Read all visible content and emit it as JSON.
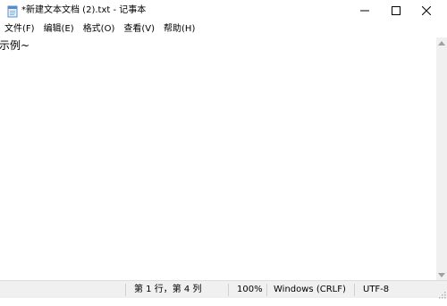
{
  "window": {
    "title": "*新建文本文档 (2).txt - 记事本",
    "icon": "notepad-icon"
  },
  "menu": {
    "items": [
      {
        "label": "文件(F)"
      },
      {
        "label": "编辑(E)"
      },
      {
        "label": "格式(O)"
      },
      {
        "label": "查看(V)"
      },
      {
        "label": "帮助(H)"
      }
    ]
  },
  "editor": {
    "content": "示例~"
  },
  "status": {
    "position": "第 1 行，第 4 列",
    "zoom": "100%",
    "line_ending": "Windows (CRLF)",
    "encoding": "UTF-8"
  }
}
